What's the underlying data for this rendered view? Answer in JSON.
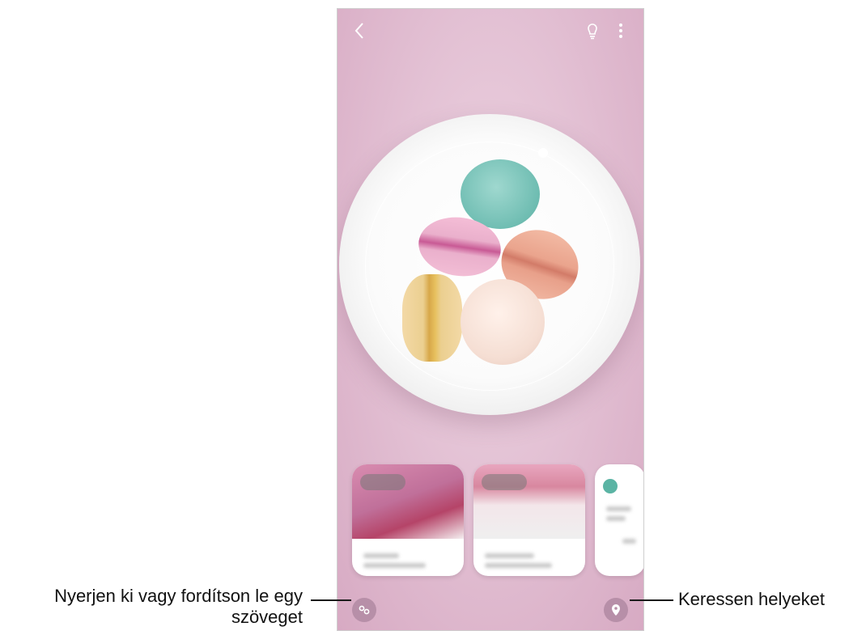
{
  "callouts": {
    "text_extract": "Nyerjen ki vagy fordítson le egy szöveget",
    "search_places": "Keressen helyeket"
  },
  "icons": {
    "back": "back-arrow-icon",
    "bixby_lens": "lightbulb-icon",
    "more": "more-options-icon",
    "text": "text-extract-icon",
    "place": "location-pin-icon"
  },
  "colors": {
    "background": "#e3c1d4",
    "button": "#b78fa8",
    "accent_teal": "#5bb4a4"
  }
}
